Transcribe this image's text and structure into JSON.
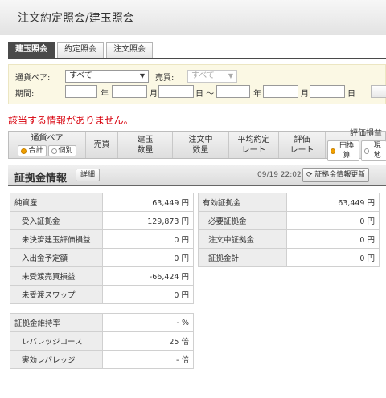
{
  "page": {
    "title": "注文約定照会/建玉照会"
  },
  "tabs": [
    {
      "label": "建玉照会",
      "active": true
    },
    {
      "label": "約定照会",
      "active": false
    },
    {
      "label": "注文照会",
      "active": false
    }
  ],
  "filter": {
    "pair_label": "通貨ペア:",
    "pair_value": "すべて",
    "side_label": "売買:",
    "side_value": "すべて",
    "period_label": "期間:",
    "year": "年",
    "month": "月",
    "day_tilde": "日 ～",
    "day": "日"
  },
  "error_message": "該当する情報がありません。",
  "table_header": {
    "pair": "通貨ペア",
    "pair_opts": [
      "合計",
      "個別"
    ],
    "side": "売買",
    "pos_qty_1": "建玉",
    "pos_qty_2": "数量",
    "order_qty_1": "注文中",
    "order_qty_2": "数量",
    "avg_rate_1": "平均約定",
    "avg_rate_2": "レート",
    "eval_rate_1": "評価",
    "eval_rate_2": "レート",
    "pl": "評価損益",
    "pl_opts": [
      "円換算",
      "現地"
    ]
  },
  "margin": {
    "title": "証拠金情報",
    "detail_button": "詳細",
    "timestamp": "09/19 22:02",
    "refresh_button": "証拠金情報更新",
    "left": [
      {
        "label": "純資産",
        "value": "63,449 円"
      },
      {
        "label": "受入証拠金",
        "value": "129,873 円"
      },
      {
        "label": "未決済建玉評価損益",
        "value": "0 円"
      },
      {
        "label": "入出金予定額",
        "value": "0 円"
      },
      {
        "label": "未受渡売買損益",
        "value": "-66,424 円"
      },
      {
        "label": "未受渡スワップ",
        "value": "0 円"
      }
    ],
    "right": [
      {
        "label": "有効証拠金",
        "value": "63,449 円"
      },
      {
        "label": "必要証拠金",
        "value": "0 円"
      },
      {
        "label": "注文中証拠金",
        "value": "0 円"
      },
      {
        "label": "証拠金計",
        "value": "0 円"
      }
    ],
    "bottom": [
      {
        "label": "証拠金維持率",
        "value": "- %"
      },
      {
        "label": "レバレッジコース",
        "value": "25 倍"
      },
      {
        "label": "実効レバレッジ",
        "value": "- 倍"
      }
    ]
  }
}
